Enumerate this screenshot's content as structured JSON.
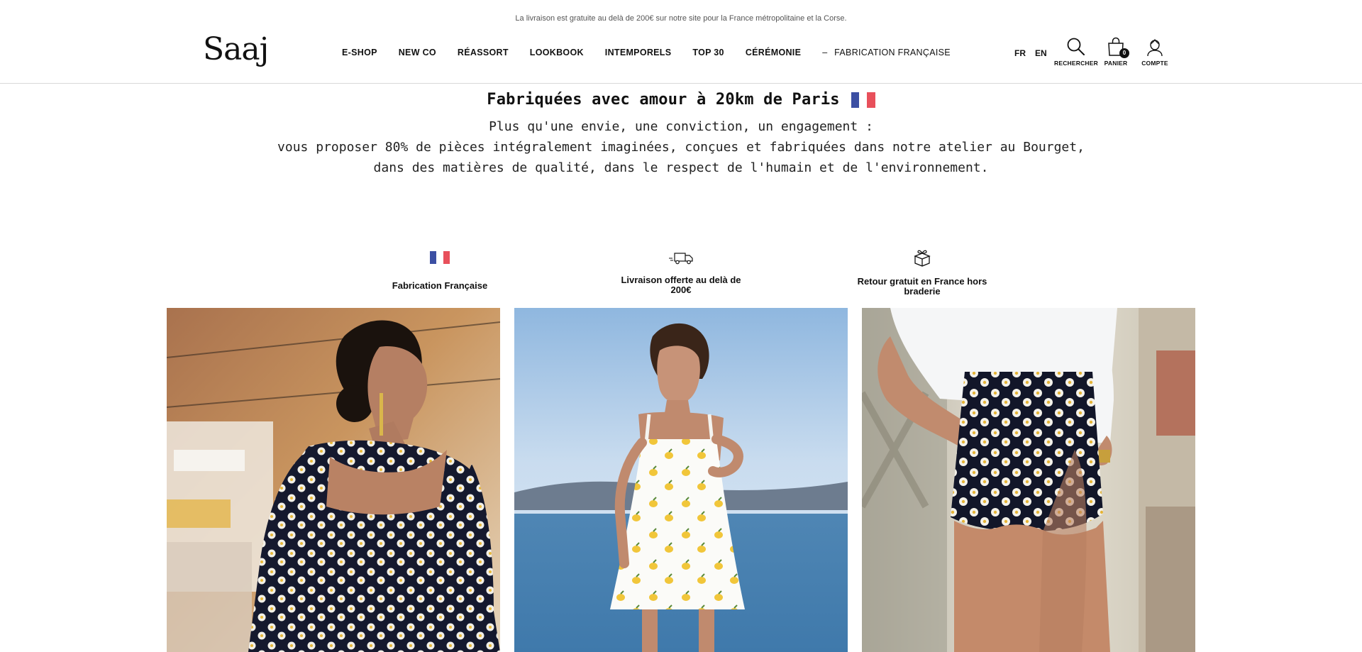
{
  "announcement": "La livraison est gratuite au delà de 200€ sur notre site pour la France métropolitaine et la Corse.",
  "header": {
    "logo": "Saaj",
    "nav": [
      {
        "label": "E-SHOP"
      },
      {
        "label": "NEW CO"
      },
      {
        "label": "RÉASSORT"
      },
      {
        "label": "LOOKBOOK"
      },
      {
        "label": "INTEMPORELS"
      },
      {
        "label": "TOP 30"
      },
      {
        "label": "CÉRÉMONIE"
      }
    ],
    "nav_dash": "–",
    "nav_extra": "FABRICATION FRANÇAISE",
    "languages": [
      "FR",
      "EN"
    ],
    "tools": {
      "search": {
        "label": "RECHERCHER",
        "icon": "search-icon"
      },
      "cart": {
        "label": "PANIER",
        "icon": "bag-icon",
        "count": "0"
      },
      "account": {
        "label": "COMPTE",
        "icon": "user-icon"
      }
    }
  },
  "hero": {
    "title": "Fabriquées avec amour à 20km de Paris",
    "lines": [
      "Plus qu'une envie, une conviction, un engagement :",
      "vous proposer 80% de pièces intégralement imaginées, conçues et fabriquées dans notre atelier au Bourget,",
      "dans des matières de qualité, dans le respect de l'humain et de l'environnement."
    ]
  },
  "features": [
    {
      "icon": "french-flag-icon",
      "text": "Fabrication Française"
    },
    {
      "icon": "delivery-truck-icon",
      "text": "Livraison offerte au delà de 200€"
    },
    {
      "icon": "gift-box-icon",
      "text": "Retour gratuit en France hors braderie"
    }
  ],
  "colors": {
    "flag_blue": "#3c4fa3",
    "flag_red": "#e8505b",
    "text": "#111111",
    "divider": "#d9d9d9"
  }
}
